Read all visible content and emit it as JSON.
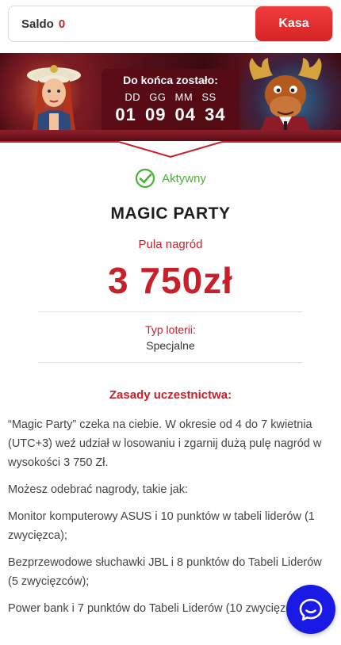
{
  "balance": {
    "label": "Saldo",
    "value": "0"
  },
  "cashier_button": "Kasa",
  "countdown": {
    "title": "Do końca zostało:",
    "units": "DD GG MM SS",
    "values": "01 09 04 34"
  },
  "status": {
    "label": "Aktywny",
    "icon": "check-circle-icon",
    "color": "#4caf37"
  },
  "lottery": {
    "title": "MAGIC PARTY",
    "pool_label": "Pula nagród",
    "pool_value": "3 750zł",
    "type_label": "Typ loterii:",
    "type_value": "Specjalne"
  },
  "rules": {
    "title": "Zasady uczestnictwa:",
    "paragraphs": [
      "“Magic Party” czeka na ciebie. W okresie od 4 do 7 kwietnia (UTC+3) weź udział w losowaniu i zgarnij dużą pulę nagród w wysokości 3 750 Zł.",
      "Możesz odebrać nagrody, takie jak:",
      "Monitor komputerowy ASUS i 10 punktów w tabeli liderów (1 zwycięzca);",
      "Bezprzewodowe słuchawki JBL i 8 punktów do Tabeli Liderów (5 zwycięzców);",
      "Power bank i 7 punktów do Tabeli Liderów (10 zwycięzców);"
    ]
  },
  "colors": {
    "accent": "#c8202a",
    "chat": "#1a1ae6"
  },
  "chat_button": {
    "icon": "chat-bubble-icon"
  }
}
